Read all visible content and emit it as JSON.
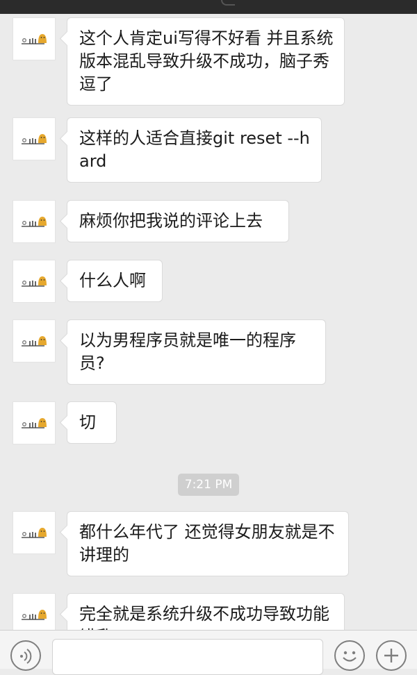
{
  "chat": {
    "messages": [
      {
        "text": "这个人肯定ui写得不好看 并且系统版本混乱导致升级不成功，脑子秀逗了"
      },
      {
        "text": "这样的人适合直接git reset --hard"
      },
      {
        "text": "麻烦你把我说的评论上去"
      },
      {
        "text": "什么人啊"
      },
      {
        "text": "以为男程序员就是唯一的程序员?"
      },
      {
        "text": "切"
      },
      {
        "text": "都什么年代了 还觉得女朋友就是不讲理的"
      },
      {
        "text": "完全就是系统升级不成功导致功能错乱"
      }
    ],
    "timestamp": "7:21 PM"
  },
  "input_bar": {
    "voice_icon": "voice-icon",
    "emoji_icon": "emoji-icon",
    "plus_icon": "plus-icon",
    "message_value": ""
  }
}
